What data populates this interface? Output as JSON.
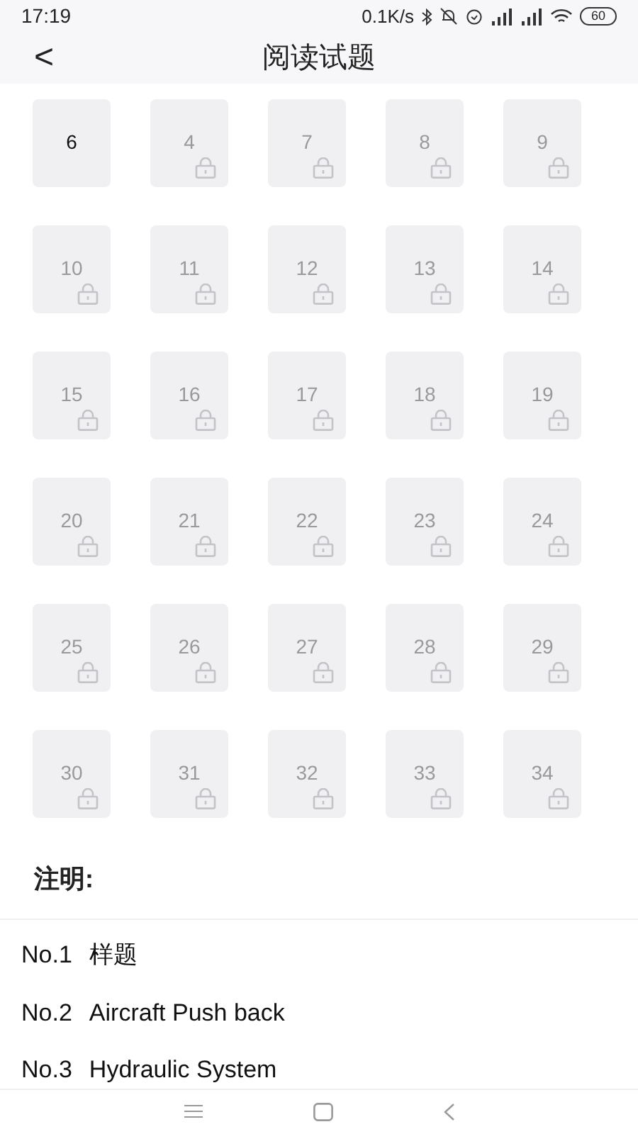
{
  "status_bar": {
    "time": "17:19",
    "speed": "0.1K/s",
    "battery": "60"
  },
  "header": {
    "back": "<",
    "title": "阅读试题"
  },
  "tiles": [
    {
      "label": "6",
      "locked": false
    },
    {
      "label": "4",
      "locked": true
    },
    {
      "label": "7",
      "locked": true
    },
    {
      "label": "8",
      "locked": true
    },
    {
      "label": "9",
      "locked": true
    },
    {
      "label": "10",
      "locked": true
    },
    {
      "label": "11",
      "locked": true
    },
    {
      "label": "12",
      "locked": true
    },
    {
      "label": "13",
      "locked": true
    },
    {
      "label": "14",
      "locked": true
    },
    {
      "label": "15",
      "locked": true
    },
    {
      "label": "16",
      "locked": true
    },
    {
      "label": "17",
      "locked": true
    },
    {
      "label": "18",
      "locked": true
    },
    {
      "label": "19",
      "locked": true
    },
    {
      "label": "20",
      "locked": true
    },
    {
      "label": "21",
      "locked": true
    },
    {
      "label": "22",
      "locked": true
    },
    {
      "label": "23",
      "locked": true
    },
    {
      "label": "24",
      "locked": true
    },
    {
      "label": "25",
      "locked": true
    },
    {
      "label": "26",
      "locked": true
    },
    {
      "label": "27",
      "locked": true
    },
    {
      "label": "28",
      "locked": true
    },
    {
      "label": "29",
      "locked": true
    },
    {
      "label": "30",
      "locked": true
    },
    {
      "label": "31",
      "locked": true
    },
    {
      "label": "32",
      "locked": true
    },
    {
      "label": "33",
      "locked": true
    },
    {
      "label": "34",
      "locked": true
    }
  ],
  "notes": {
    "heading": "注明:",
    "items": [
      {
        "number": "No.1",
        "title": "样题"
      },
      {
        "number": "No.2",
        "title": "Aircraft Push back"
      },
      {
        "number": "No.3",
        "title": "Hydraulic System"
      }
    ]
  }
}
